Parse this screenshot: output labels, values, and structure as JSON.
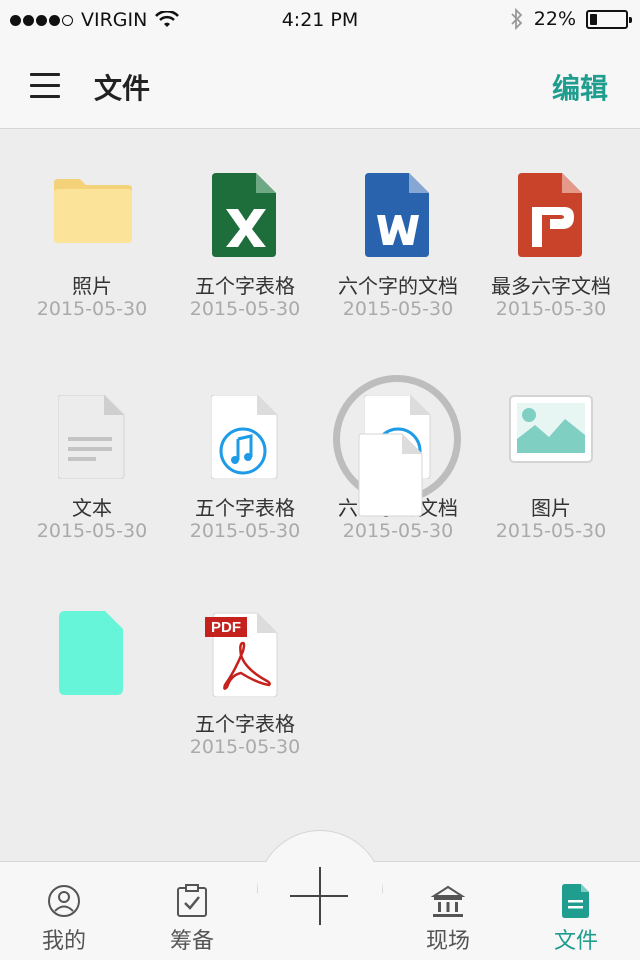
{
  "status_bar": {
    "carrier": "VIRGIN",
    "time": "4:21 PM",
    "battery": "22%",
    "battery_level": 0.22,
    "signal_bars": 5,
    "signal_filled": 4
  },
  "nav": {
    "title": "文件",
    "edit_label": "编辑",
    "accent_color": "#1f9d8f"
  },
  "files": [
    {
      "name": "照片",
      "date": "2015-05-30",
      "icon": "folder-icon"
    },
    {
      "name": "五个字表格",
      "date": "2015-05-30",
      "icon": "excel-icon"
    },
    {
      "name": "六个字的文档",
      "date": "2015-05-30",
      "icon": "word-icon"
    },
    {
      "name": "最多六字文档",
      "date": "2015-05-30",
      "icon": "powerpoint-icon"
    },
    {
      "name": "文本",
      "date": "2015-05-30",
      "icon": "text-file-icon"
    },
    {
      "name": "五个字表格",
      "date": "2015-05-30",
      "icon": "music-file-icon"
    },
    {
      "name": "六个字的文档",
      "date": "2015-05-30",
      "icon": "music-file-icon"
    },
    {
      "name": "图片",
      "date": "2015-05-30",
      "icon": "image-file-icon"
    },
    {
      "name": "",
      "date": "",
      "icon": "blank-file-icon"
    },
    {
      "name": "五个字表格",
      "date": "2015-05-30",
      "icon": "pdf-icon"
    }
  ],
  "pdf_badge": "PDF",
  "tabs": [
    {
      "label": "我的",
      "icon": "user-icon"
    },
    {
      "label": "筹备",
      "icon": "clipboard-check-icon"
    },
    {
      "label": "现场",
      "icon": "bank-icon"
    },
    {
      "label": "文件",
      "icon": "file-icon",
      "active": true
    }
  ]
}
